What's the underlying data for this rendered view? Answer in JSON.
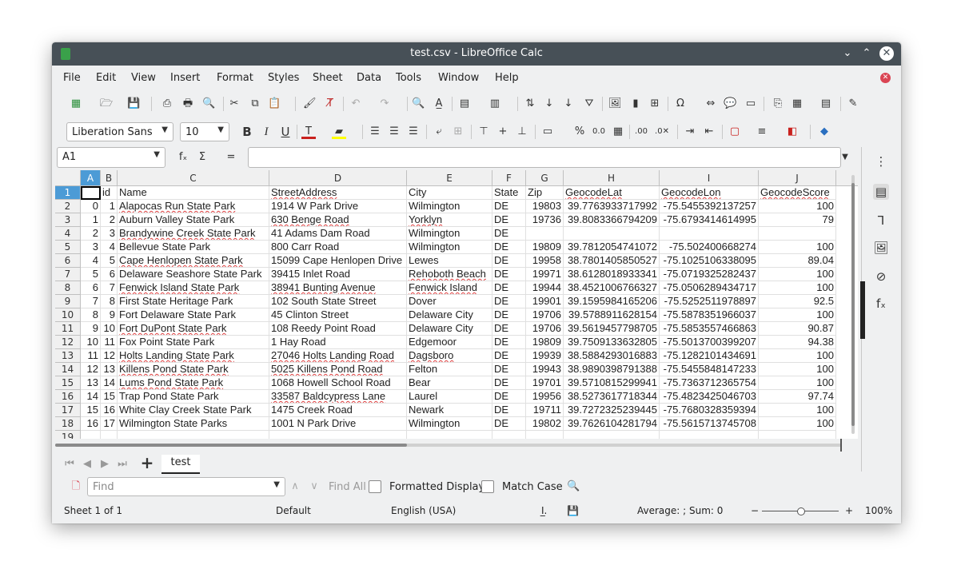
{
  "window": {
    "title": "test.csv - LibreOffice Calc"
  },
  "menu": [
    "File",
    "Edit",
    "View",
    "Insert",
    "Format",
    "Styles",
    "Sheet",
    "Data",
    "Tools",
    "Window",
    "Help"
  ],
  "font": {
    "name": "Liberation Sans",
    "size": "10"
  },
  "formula_bar": {
    "cell_ref": "A1",
    "fx": "fₓ",
    "sum": "Σ",
    "equals": "=",
    "content": ""
  },
  "columns": [
    "A",
    "B",
    "C",
    "D",
    "E",
    "F",
    "G",
    "H",
    "I",
    "J"
  ],
  "rows": [
    [
      "",
      "id",
      "Name",
      "StreetAddress",
      "City",
      "State",
      "Zip",
      "GeocodeLat",
      "GeocodeLon",
      "GeocodeScore"
    ],
    [
      "0",
      "1",
      "Alapocas Run State Park",
      "1914 W Park Drive",
      "Wilmington",
      "DE",
      "19803",
      "39.7763933717992",
      "-75.5455392137257",
      "100"
    ],
    [
      "1",
      "2",
      "Auburn Valley State Park",
      "630 Benge Road",
      "Yorklyn",
      "DE",
      "19736",
      "39.8083366794209",
      "-75.6793414614995",
      "79"
    ],
    [
      "2",
      "3",
      "Brandywine Creek State Park",
      "41 Adams Dam Road",
      "Wilmington",
      "DE",
      "",
      "",
      "",
      ""
    ],
    [
      "3",
      "4",
      "Bellevue State Park",
      "800 Carr Road",
      "Wilmington",
      "DE",
      "19809",
      "39.7812054741072",
      "-75.502400668274",
      "100"
    ],
    [
      "4",
      "5",
      "Cape Henlopen State Park",
      "15099 Cape Henlopen Drive",
      "Lewes",
      "DE",
      "19958",
      "38.7801405850527",
      "-75.1025106338095",
      "89.04"
    ],
    [
      "5",
      "6",
      "Delaware Seashore State Park",
      "39415 Inlet Road",
      "Rehoboth Beach",
      "DE",
      "19971",
      "38.6128018933341",
      "-75.0719325282437",
      "100"
    ],
    [
      "6",
      "7",
      "Fenwick Island State Park",
      "38941 Bunting Avenue",
      "Fenwick Island",
      "DE",
      "19944",
      "38.4521006766327",
      "-75.0506289434717",
      "100"
    ],
    [
      "7",
      "8",
      "First State Heritage Park",
      "102 South State Street",
      "Dover",
      "DE",
      "19901",
      "39.1595984165206",
      "-75.5252511978897",
      "92.5"
    ],
    [
      "8",
      "9",
      "Fort Delaware State Park",
      "45 Clinton Street",
      "Delaware City",
      "DE",
      "19706",
      "39.5788911628154",
      "-75.5878351966037",
      "100"
    ],
    [
      "9",
      "10",
      "Fort DuPont State Park",
      "108 Reedy Point Road",
      "Delaware City",
      "DE",
      "19706",
      "39.5619457798705",
      "-75.5853557466863",
      "90.87"
    ],
    [
      "10",
      "11",
      "Fox Point State Park",
      "1 Hay Road",
      "Edgemoor",
      "DE",
      "19809",
      "39.7509133632805",
      "-75.5013700399207",
      "94.38"
    ],
    [
      "11",
      "12",
      "Holts Landing State Park",
      "27046 Holts Landing Road",
      "Dagsboro",
      "DE",
      "19939",
      "38.5884293016883",
      "-75.1282101434691",
      "100"
    ],
    [
      "12",
      "13",
      "Killens Pond State Park",
      "5025 Killens Pond Road",
      "Felton",
      "DE",
      "19943",
      "38.9890398791388",
      "-75.5455848147233",
      "100"
    ],
    [
      "13",
      "14",
      "Lums Pond State Park",
      "1068 Howell School Road",
      "Bear",
      "DE",
      "19701",
      "39.5710815299941",
      "-75.7363712365754",
      "100"
    ],
    [
      "14",
      "15",
      "Trap Pond State Park",
      "33587 Baldcypress Lane",
      "Laurel",
      "DE",
      "19956",
      "38.5273617718344",
      "-75.4823425046703",
      "97.74"
    ],
    [
      "15",
      "16",
      "White Clay Creek State Park",
      "1475 Creek Road",
      "Newark",
      "DE",
      "19711",
      "39.7272325239445",
      "-75.7680328359394",
      "100"
    ],
    [
      "16",
      "17",
      "Wilmington State Parks",
      "1001 N Park Drive",
      "Wilmington",
      "DE",
      "19802",
      "39.7626104281794",
      "-75.5615713745708",
      "100"
    ]
  ],
  "row_numbers": [
    "1",
    "2",
    "3",
    "4",
    "5",
    "6",
    "7",
    "8",
    "9",
    "10",
    "11",
    "12",
    "13",
    "14",
    "15",
    "16",
    "17",
    "18",
    "19"
  ],
  "sheet_tab": "test",
  "findbar": {
    "placeholder": "Find",
    "find_all": "Find All",
    "formatted_display": "Formatted Display",
    "match_case": "Match Case"
  },
  "status": {
    "sheet": "Sheet 1 of 1",
    "style": "Default",
    "language": "English (USA)",
    "aggregate": "Average: ; Sum: 0",
    "zoom": "100%"
  },
  "colors": {
    "titlebar": "#475057",
    "selection": "#4c9bd6",
    "close_doc": "#da4453"
  }
}
